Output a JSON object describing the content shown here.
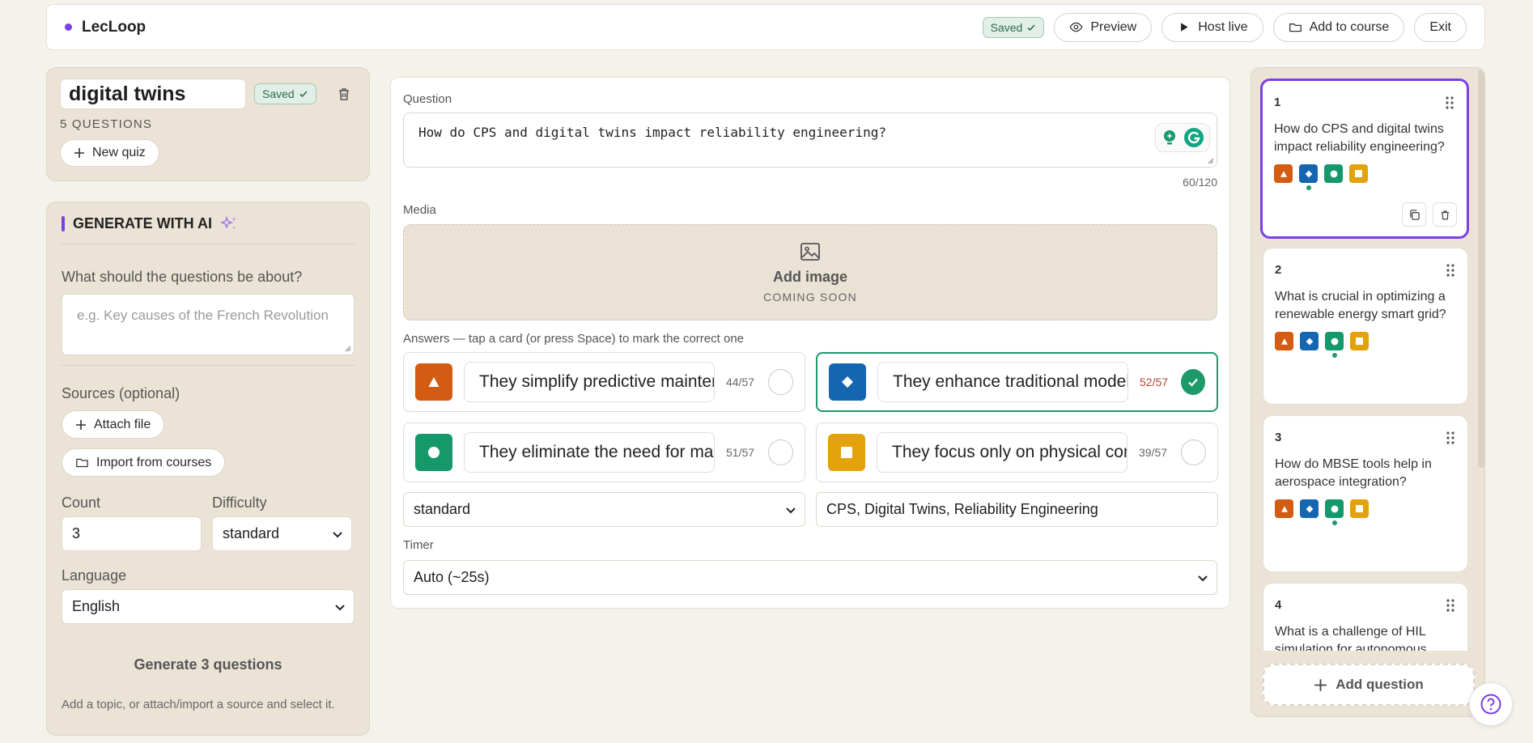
{
  "topbar": {
    "brand": "LecLoop",
    "saved_badge": "Saved",
    "preview": "Preview",
    "host_live": "Host live",
    "add_to_course": "Add to course",
    "exit": "Exit"
  },
  "quiz": {
    "title": "digital twins",
    "saved_badge": "Saved",
    "question_count": "5 QUESTIONS",
    "new_quiz": "New quiz"
  },
  "ai": {
    "heading": "GENERATE WITH AI",
    "topic_label": "What should the questions be about?",
    "topic_placeholder": "e.g. Key causes of the French Revolution",
    "sources_label": "Sources (optional)",
    "attach_file": "Attach file",
    "import_courses": "Import from courses",
    "count_label": "Count",
    "count_value": "3",
    "difficulty_label": "Difficulty",
    "difficulty_value": "standard",
    "language_label": "Language",
    "language_value": "English",
    "generate_button": "Generate 3 questions",
    "hint": "Add a topic, or attach/import a source and select it."
  },
  "editor": {
    "question_label": "Question",
    "question_text": "How do CPS and digital twins impact reliability engineering?",
    "char_count": "60/120",
    "media_label": "Media",
    "add_image": "Add image",
    "coming_soon": "COMING SOON",
    "answers_label": "Answers — tap a card (or press Space) to mark the correct one",
    "answers": [
      {
        "text": "They simplify predictive maintenance",
        "count": "44/57",
        "shape": "triangle",
        "color": "#d45b12",
        "correct": false
      },
      {
        "text": "They enhance traditional models",
        "count": "52/57",
        "shape": "diamond",
        "color": "#1565b0",
        "correct": true
      },
      {
        "text": "They eliminate the need for maintenance",
        "count": "51/57",
        "shape": "circle",
        "color": "#15996a",
        "correct": false
      },
      {
        "text": "They focus only on physical components",
        "count": "39/57",
        "shape": "square",
        "color": "#e3a10a",
        "correct": false
      }
    ],
    "difficulty_value": "standard",
    "tags_value": "CPS, Digital Twins, Reliability Engineering",
    "timer_label": "Timer",
    "timer_value": "Auto (~25s)"
  },
  "questions": [
    {
      "num": "1",
      "text": "How do CPS and digital twins impact reliability engineering?",
      "correct_index": 1
    },
    {
      "num": "2",
      "text": "What is crucial in optimizing a renewable energy smart grid?",
      "correct_index": 2
    },
    {
      "num": "3",
      "text": "How do MBSE tools help in aerospace integration?",
      "correct_index": 2
    },
    {
      "num": "4",
      "text": "What is a challenge of HIL simulation for autonomous",
      "correct_index": 0
    }
  ],
  "add_question": "Add question",
  "colors": {
    "accent": "#7b3fe4",
    "correct": "#1e9a6a"
  }
}
